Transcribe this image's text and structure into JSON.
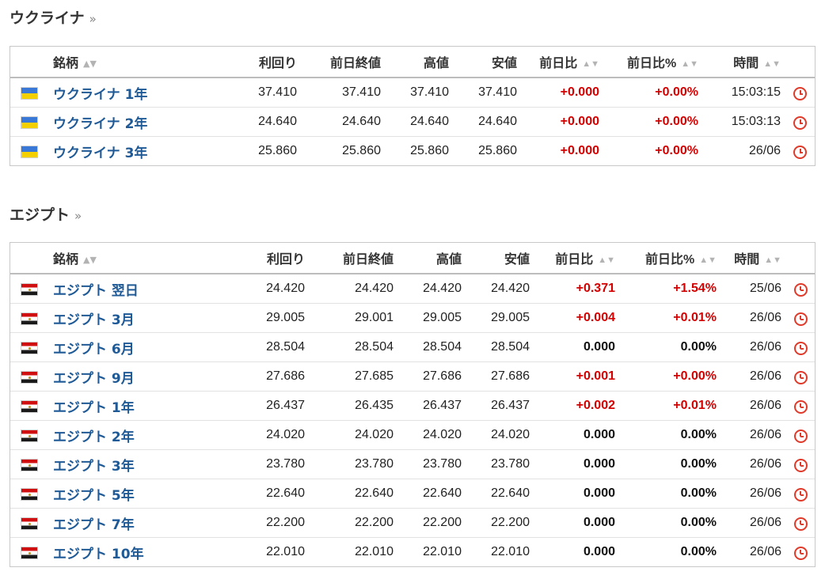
{
  "sections": [
    {
      "title": "ウクライナ",
      "more": "»",
      "headers": {
        "name": "銘柄",
        "yield": "利回り",
        "prev_close": "前日終値",
        "high": "高値",
        "low": "安値",
        "change": "前日比",
        "change_pct": "前日比%",
        "time": "時間"
      },
      "rows": [
        {
          "flag": "ua",
          "name": "ウクライナ 1年",
          "yield": "37.410",
          "prev_close": "37.410",
          "high": "37.410",
          "low": "37.410",
          "change": "+0.000",
          "change_pct": "+0.00%",
          "time": "15:03:15",
          "dir": "up"
        },
        {
          "flag": "ua",
          "name": "ウクライナ 2年",
          "yield": "24.640",
          "prev_close": "24.640",
          "high": "24.640",
          "low": "24.640",
          "change": "+0.000",
          "change_pct": "+0.00%",
          "time": "15:03:13",
          "dir": "up"
        },
        {
          "flag": "ua",
          "name": "ウクライナ 3年",
          "yield": "25.860",
          "prev_close": "25.860",
          "high": "25.860",
          "low": "25.860",
          "change": "+0.000",
          "change_pct": "+0.00%",
          "time": "26/06",
          "dir": "up"
        }
      ]
    },
    {
      "title": "エジプト",
      "more": "»",
      "headers": {
        "name": "銘柄",
        "yield": "利回り",
        "prev_close": "前日終値",
        "high": "高値",
        "low": "安値",
        "change": "前日比",
        "change_pct": "前日比%",
        "time": "時間"
      },
      "rows": [
        {
          "flag": "eg",
          "name": "エジプト 翌日",
          "yield": "24.420",
          "prev_close": "24.420",
          "high": "24.420",
          "low": "24.420",
          "change": "+0.371",
          "change_pct": "+1.54%",
          "time": "25/06",
          "dir": "up"
        },
        {
          "flag": "eg",
          "name": "エジプト 3月",
          "yield": "29.005",
          "prev_close": "29.001",
          "high": "29.005",
          "low": "29.005",
          "change": "+0.004",
          "change_pct": "+0.01%",
          "time": "26/06",
          "dir": "up"
        },
        {
          "flag": "eg",
          "name": "エジプト 6月",
          "yield": "28.504",
          "prev_close": "28.504",
          "high": "28.504",
          "low": "28.504",
          "change": "0.000",
          "change_pct": "0.00%",
          "time": "26/06",
          "dir": "flat"
        },
        {
          "flag": "eg",
          "name": "エジプト 9月",
          "yield": "27.686",
          "prev_close": "27.685",
          "high": "27.686",
          "low": "27.686",
          "change": "+0.001",
          "change_pct": "+0.00%",
          "time": "26/06",
          "dir": "up"
        },
        {
          "flag": "eg",
          "name": "エジプト 1年",
          "yield": "26.437",
          "prev_close": "26.435",
          "high": "26.437",
          "low": "26.437",
          "change": "+0.002",
          "change_pct": "+0.01%",
          "time": "26/06",
          "dir": "up"
        },
        {
          "flag": "eg",
          "name": "エジプト 2年",
          "yield": "24.020",
          "prev_close": "24.020",
          "high": "24.020",
          "low": "24.020",
          "change": "0.000",
          "change_pct": "0.00%",
          "time": "26/06",
          "dir": "flat"
        },
        {
          "flag": "eg",
          "name": "エジプト 3年",
          "yield": "23.780",
          "prev_close": "23.780",
          "high": "23.780",
          "low": "23.780",
          "change": "0.000",
          "change_pct": "0.00%",
          "time": "26/06",
          "dir": "flat"
        },
        {
          "flag": "eg",
          "name": "エジプト 5年",
          "yield": "22.640",
          "prev_close": "22.640",
          "high": "22.640",
          "low": "22.640",
          "change": "0.000",
          "change_pct": "0.00%",
          "time": "26/06",
          "dir": "flat"
        },
        {
          "flag": "eg",
          "name": "エジプト 7年",
          "yield": "22.200",
          "prev_close": "22.200",
          "high": "22.200",
          "low": "22.200",
          "change": "0.000",
          "change_pct": "0.00%",
          "time": "26/06",
          "dir": "flat"
        },
        {
          "flag": "eg",
          "name": "エジプト 10年",
          "yield": "22.010",
          "prev_close": "22.010",
          "high": "22.010",
          "low": "22.010",
          "change": "0.000",
          "change_pct": "0.00%",
          "time": "26/06",
          "dir": "flat"
        }
      ]
    }
  ],
  "sort_icon": "sort-arrows-icon",
  "row_icon": "clock-icon",
  "colors": {
    "link": "#1f5a96",
    "up": "#d40000",
    "flat": "#111111",
    "clock": "#e03a2a"
  }
}
